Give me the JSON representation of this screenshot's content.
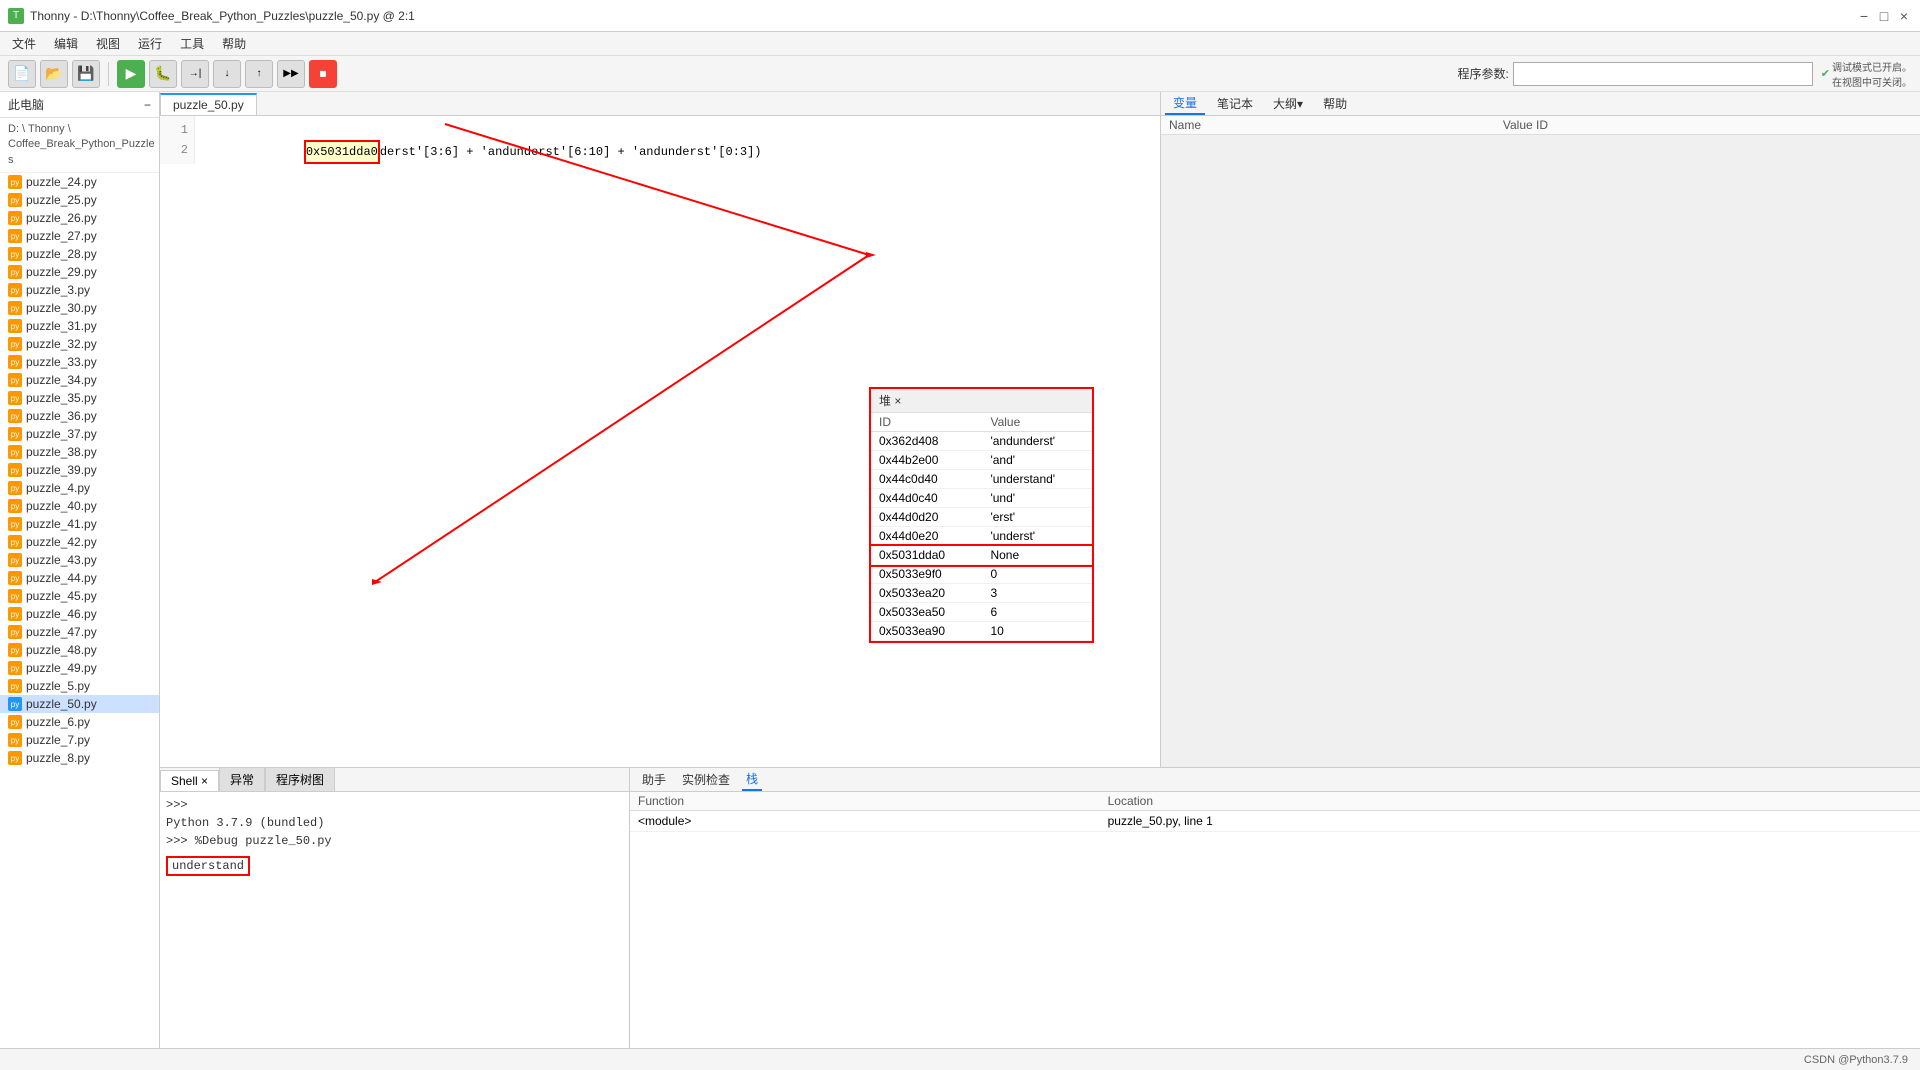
{
  "titlebar": {
    "title": "Thonny - D:\\Thonny\\Coffee_Break_Python_Puzzles\\puzzle_50.py @ 2:1",
    "icon": "T",
    "min_label": "−",
    "max_label": "□",
    "close_label": "×"
  },
  "menubar": {
    "items": [
      "文件",
      "编辑",
      "视图",
      "运行",
      "工具",
      "帮助"
    ]
  },
  "toolbar": {
    "buttons": [
      "📁",
      "💾",
      "🔧"
    ],
    "run_label": "▶",
    "debug_label": "🐛",
    "step_over": "→|",
    "step_into": "↓",
    "step_out": "↑",
    "stop_label": "⏹",
    "program_args_label": "程序参数:",
    "debug_note": "调试模式已开启。\n在视图中可关闭。"
  },
  "sidebar": {
    "header": "此电脑",
    "path_lines": [
      "D: \\ Thonny \\",
      "Coffee_Break_Python_Puzzle",
      "s"
    ],
    "items": [
      {
        "label": "puzzle_24.py",
        "active": false
      },
      {
        "label": "puzzle_25.py",
        "active": false
      },
      {
        "label": "puzzle_26.py",
        "active": false
      },
      {
        "label": "puzzle_27.py",
        "active": false
      },
      {
        "label": "puzzle_28.py",
        "active": false
      },
      {
        "label": "puzzle_29.py",
        "active": false
      },
      {
        "label": "puzzle_3.py",
        "active": false
      },
      {
        "label": "puzzle_30.py",
        "active": false
      },
      {
        "label": "puzzle_31.py",
        "active": false
      },
      {
        "label": "puzzle_32.py",
        "active": false
      },
      {
        "label": "puzzle_33.py",
        "active": false
      },
      {
        "label": "puzzle_34.py",
        "active": false
      },
      {
        "label": "puzzle_35.py",
        "active": false
      },
      {
        "label": "puzzle_36.py",
        "active": false
      },
      {
        "label": "puzzle_37.py",
        "active": false
      },
      {
        "label": "puzzle_38.py",
        "active": false
      },
      {
        "label": "puzzle_39.py",
        "active": false
      },
      {
        "label": "puzzle_4.py",
        "active": false
      },
      {
        "label": "puzzle_40.py",
        "active": false
      },
      {
        "label": "puzzle_41.py",
        "active": false
      },
      {
        "label": "puzzle_42.py",
        "active": false
      },
      {
        "label": "puzzle_43.py",
        "active": false
      },
      {
        "label": "puzzle_44.py",
        "active": false
      },
      {
        "label": "puzzle_45.py",
        "active": false
      },
      {
        "label": "puzzle_46.py",
        "active": false
      },
      {
        "label": "puzzle_47.py",
        "active": false
      },
      {
        "label": "puzzle_48.py",
        "active": false
      },
      {
        "label": "puzzle_49.py",
        "active": false
      },
      {
        "label": "puzzle_5.py",
        "active": false
      },
      {
        "label": "puzzle_50.py",
        "active": true
      },
      {
        "label": "puzzle_6.py",
        "active": false
      },
      {
        "label": "puzzle_7.py",
        "active": false
      },
      {
        "label": "puzzle_8.py",
        "active": false
      }
    ]
  },
  "editor": {
    "tab_label": "puzzle_50.py",
    "lines": [
      {
        "num": "1",
        "code_prefix": "0x5031dda0",
        "code_suffix": "derst'[3:6] + 'andunderst'[6:10] + 'andunderst'[0:3])"
      },
      {
        "num": "2",
        "code": ""
      }
    ]
  },
  "variables_panel": {
    "tabs": [
      "变量",
      "笔记本",
      "大纲▾",
      "帮助"
    ],
    "columns": [
      "Name",
      "Value ID"
    ],
    "rows": []
  },
  "heap_panel": {
    "tab_label": "堆 ×",
    "columns": [
      "ID",
      "Value"
    ],
    "rows": [
      {
        "id": "0x362d408",
        "value": "'andunderst'"
      },
      {
        "id": "0x44b2e00",
        "value": "'and'"
      },
      {
        "id": "0x44c0d40",
        "value": "'understand'"
      },
      {
        "id": "0x44d0c40",
        "value": "'und'"
      },
      {
        "id": "0x44d0d20",
        "value": "'erst'"
      },
      {
        "id": "0x44d0e20",
        "value": "'underst'"
      },
      {
        "id": "0x5031dda0",
        "value": "None",
        "highlighted": true
      },
      {
        "id": "0x5033e9f0",
        "value": "0"
      },
      {
        "id": "0x5033ea20",
        "value": "3"
      },
      {
        "id": "0x5033ea50",
        "value": "6"
      },
      {
        "id": "0x5033ea90",
        "value": "10"
      }
    ]
  },
  "shell": {
    "tabs": [
      "Shell",
      "异常",
      "程序树图"
    ],
    "active_tab": "Shell",
    "content": [
      ">>>",
      "Python 3.7.9 (bundled)",
      ">>> %Debug puzzle_50.py"
    ],
    "output_highlighted": "understand"
  },
  "stack_panel": {
    "tabs": [
      "助手",
      "实例检查",
      "栈"
    ],
    "active_tab": "栈",
    "columns": [
      "Function",
      "Location"
    ],
    "rows": [
      {
        "function": "<module>",
        "location": "puzzle_50.py, line 1"
      }
    ]
  },
  "statusbar": {
    "text": "CSDN @Python3.7.9"
  }
}
